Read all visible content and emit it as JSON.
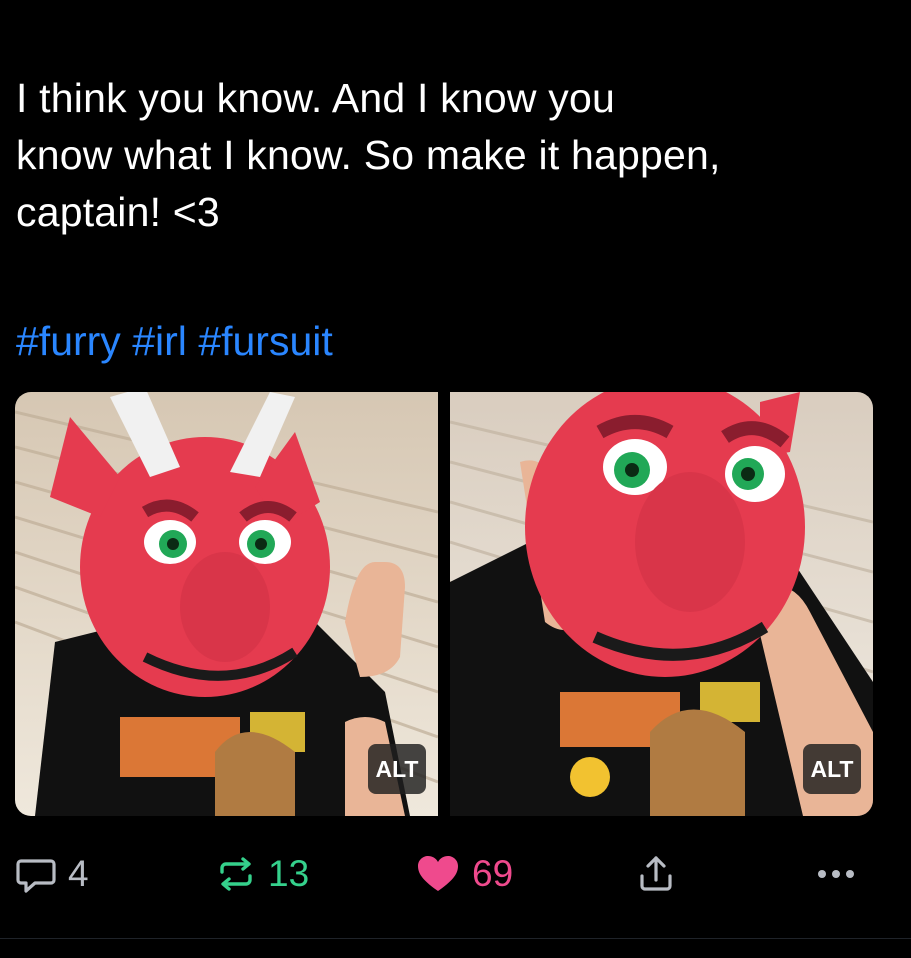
{
  "post": {
    "text_lines": [
      "I think you know. And I know you",
      "know what I know. So make it happen,",
      "captain! <3"
    ],
    "hashtags": [
      "#furry",
      "#irl",
      "#fursuit"
    ]
  },
  "media": [
    {
      "alt_label": "ALT"
    },
    {
      "alt_label": "ALT"
    }
  ],
  "actions": {
    "reply_count": "4",
    "repost_count": "13",
    "like_count": "69"
  },
  "colors": {
    "background": "#000000",
    "hashtag": "#2a86ff",
    "repost": "#35d18c",
    "like": "#ef4a8d",
    "muted": "#b8bcc4"
  }
}
